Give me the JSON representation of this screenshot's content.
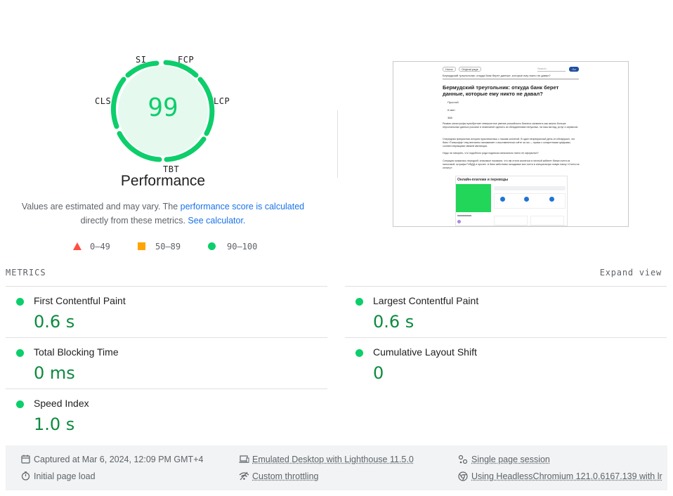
{
  "gauge": {
    "score": "99",
    "title": "Performance",
    "labels": {
      "si": "SI",
      "fcp": "FCP",
      "lcp": "LCP",
      "tbt": "TBT",
      "cls": "CLS"
    },
    "color": "#0cce6b"
  },
  "description": {
    "part1": "Values are estimated and may vary. The ",
    "link1": "performance score is calculated",
    "part2": "directly from these metrics. ",
    "link2": "See calculator."
  },
  "legend": {
    "fail": "0–49",
    "average": "50–89",
    "pass": "90–100",
    "colors": {
      "fail": "#ff4e42",
      "average": "#ffa400",
      "pass": "#0cce6b"
    }
  },
  "screenshot": {
    "home_btn": "Home",
    "original_btn": "Original page",
    "search_placeholder": "Search",
    "go_btn": "Go",
    "breadcrumb": "Бермудский треугольник: откуда банк берет данные, которые ему никто не давал?",
    "heading": "Бермудский треугольник: откуда банк берет данные, которые ему никто не давал?",
    "meta1": "Простой",
    "meta2": "6 мин",
    "meta3": "388",
    "para1": "Размах катастрофы приобретает невероятное рвение российского бизнеса захватить как можно больше персональных данных россиян и нежелание сделать их обладателями ненужных, на наш взгляд, услуг и сервисов.",
    "para2": "Очередная прекрасная история приключилась с нашим коллегой. В один непрекрасный день он обнаружил, что банк «Тинькофф» ему внезапно напоминает о выставленном счёте за газ — прямо с конкретными цифрами, соответствующими свежей квитанции.",
    "para3": "Надо ли говорить, что подобного рода подписка изначально никто не оформлял?",
    "para4": "Ситуация оказалась нередкой: знакомые показали, что им стали сыпаться в личный кабинет банка счета из налоговой, штрафы ГИБДД и прочее. А банк заботливо складывал все счета в специальную новую папку «Счета на оплату».",
    "widget_title": "Онлайн-платежи и переводы"
  },
  "metrics": {
    "title": "METRICS",
    "expand": "Expand view",
    "items": [
      {
        "name": "First Contentful Paint",
        "value": "0.6 s"
      },
      {
        "name": "Largest Contentful Paint",
        "value": "0.6 s"
      },
      {
        "name": "Total Blocking Time",
        "value": "0 ms"
      },
      {
        "name": "Cumulative Layout Shift",
        "value": "0"
      },
      {
        "name": "Speed Index",
        "value": "1.0 s"
      }
    ]
  },
  "footer": {
    "captured": "Captured at Mar 6, 2024, 12:09 PM GMT+4",
    "initial_load": "Initial page load",
    "emulated": "Emulated Desktop with Lighthouse 11.5.0",
    "throttling": "Custom throttling",
    "session": "Single page session",
    "browser": "Using HeadlessChromium 121.0.6167.139 with lr",
    "icons": [
      "calendar-icon",
      "timer-icon",
      "laptop-icon",
      "wifi-icon",
      "session-icon",
      "chromium-icon"
    ]
  }
}
